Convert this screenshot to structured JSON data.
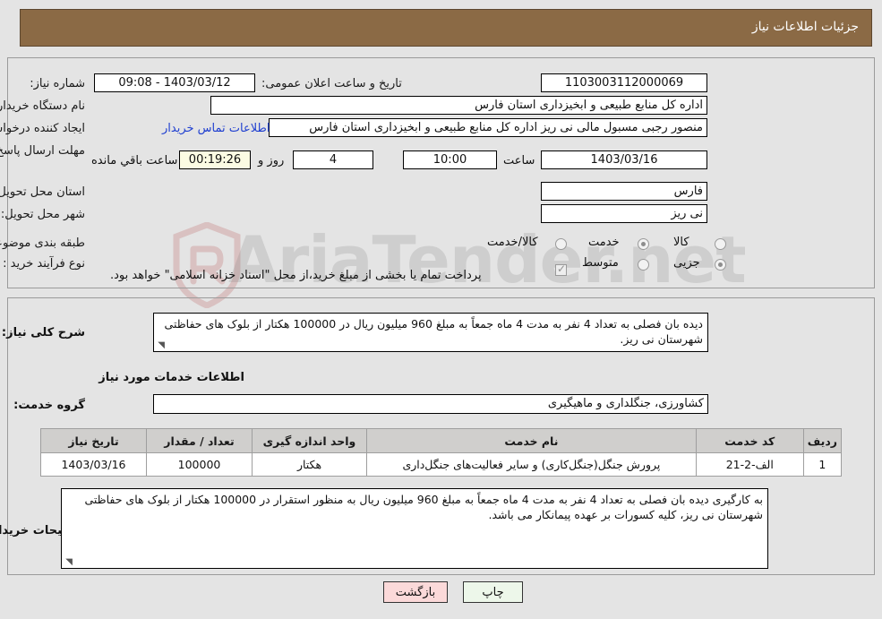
{
  "header": {
    "title": "جزئیات اطلاعات نیاز"
  },
  "watermark": {
    "text": "AriaTender.net"
  },
  "form": {
    "need_number": {
      "label": "شماره نیاز:",
      "value": "1103003112000069"
    },
    "public_announce_datetime": {
      "label": "تاریخ و ساعت اعلان عمومی:",
      "value": "1403/03/12 - 09:08"
    },
    "buyer_org": {
      "label": "نام دستگاه خریدار:",
      "value": "اداره کل منابع طبیعی و ابخیزداری استان فارس"
    },
    "request_creator": {
      "label": "ایجاد کننده درخواست:",
      "value": "منصور رجبی مسبول مالی نی ریز اداره کل منابع طبیعی و ابخیزداری استان فارس",
      "contact_link": "اطلاعات تماس خریدار"
    },
    "response_deadline": {
      "label": "مهلت ارسال پاسخ: تا تاریخ:",
      "date": "1403/03/16",
      "time_label": "ساعت",
      "time": "10:00",
      "days": "4",
      "days_label": "روز و",
      "countdown": "00:19:26",
      "countdown_label": "ساعت باقي مانده"
    },
    "delivery_province": {
      "label": "استان محل تحویل:",
      "value": "فارس"
    },
    "delivery_city": {
      "label": "شهر محل تحویل:",
      "value": "نی ریز"
    },
    "category": {
      "label": "طبقه بندی موضوعی:",
      "options": [
        {
          "label": "کالا",
          "selected": false
        },
        {
          "label": "خدمت",
          "selected": true
        },
        {
          "label": "کالا/خدمت",
          "selected": false
        }
      ]
    },
    "purchase_process": {
      "label": "نوع فرآیند خرید :",
      "options": [
        {
          "label": "جزیی",
          "selected": true
        },
        {
          "label": "متوسط",
          "selected": false
        }
      ],
      "payment_note": "پرداخت تمام یا بخشی از مبلغ خرید،از محل \"اسناد خزانه اسلامی\" خواهد بود.",
      "payment_checked": true
    },
    "general_description": {
      "label": "شرح کلی نیاز:",
      "value": "دیده بان فصلی به تعداد 4 نفر به مدت 4 ماه جمعاً به مبلغ 960 میلیون ریال در 100000 هکتار از بلوک های حفاظتی شهرستان نی ریز."
    },
    "services_section_title": "اطلاعات خدمات مورد نیاز",
    "service_group": {
      "label": "گروه خدمت:",
      "value": "کشاورزی، جنگلداری و ماهیگیری"
    },
    "buyer_notes": {
      "label": "توضیحات خریدار:",
      "value": "به کارگیری دیده بان فصلی به تعداد 4 نفر به مدت 4 ماه جمعاً به مبلغ 960 میلیون ریال به منظور استقرار در 100000 هکتار از بلوک های حفاظتی شهرستان نی ریز، کلیه کسورات بر عهده پیمانکار می باشد."
    }
  },
  "table": {
    "headers": [
      "ردیف",
      "کد خدمت",
      "نام خدمت",
      "واحد اندازه گیری",
      "تعداد / مقدار",
      "تاریخ نیاز"
    ],
    "rows": [
      {
        "row": "1",
        "service_code": "الف-2-21",
        "service_name": "پرورش جنگل(جنگل‌کاری) و سایر فعالیت‌های جنگل‌داری",
        "unit": "هکتار",
        "quantity": "100000",
        "need_date": "1403/03/16"
      }
    ]
  },
  "buttons": {
    "print": "چاپ",
    "back": "بازگشت"
  },
  "colors": {
    "header_bg": "#8b6a45",
    "page_bg": "#e4e4e4",
    "link": "#1f3fd0",
    "countdown_bg": "#fbfbe3",
    "back_btn_bg": "#fbd9d9",
    "print_btn_bg": "#edf7ea",
    "table_header_bg": "#d0cfcd"
  }
}
